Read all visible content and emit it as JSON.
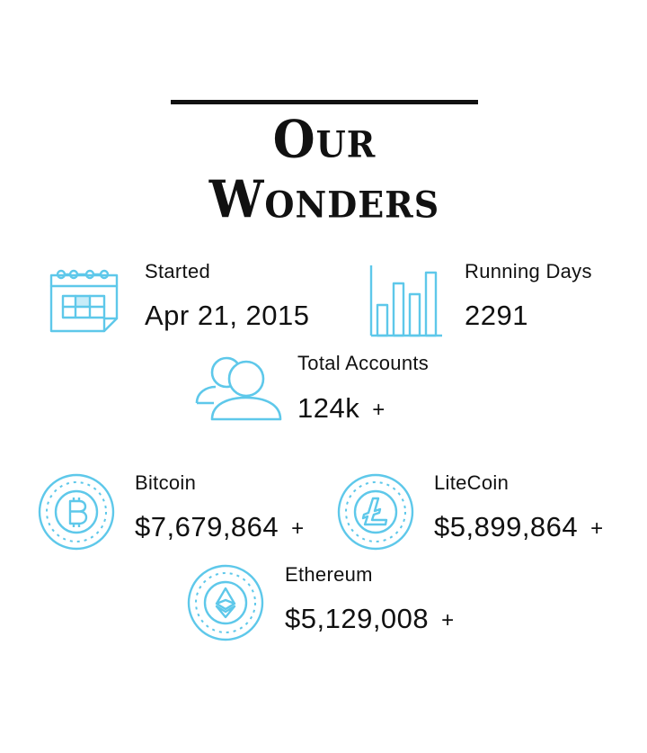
{
  "header": {
    "title": "Our Wonders"
  },
  "stats": {
    "started": {
      "label": "Started",
      "value": "Apr 21, 2015",
      "icon": "calendar-icon"
    },
    "running_days": {
      "label": "Running Days",
      "value": "2291",
      "icon": "bar-chart-icon"
    },
    "total_accounts": {
      "label": "Total Accounts",
      "value": "124k",
      "suffix": "+",
      "icon": "users-icon"
    },
    "bitcoin": {
      "label": "Bitcoin",
      "value": "$7,679,864",
      "suffix": "+",
      "icon": "bitcoin-icon"
    },
    "litecoin": {
      "label": "LiteCoin",
      "value": "$5,899,864",
      "suffix": "+",
      "icon": "litecoin-icon"
    },
    "ethereum": {
      "label": "Ethereum",
      "value": "$5,129,008",
      "suffix": "+",
      "icon": "ethereum-icon"
    }
  },
  "colors": {
    "accent": "#5ec8ea",
    "text": "#111111",
    "background": "#ffffff"
  }
}
